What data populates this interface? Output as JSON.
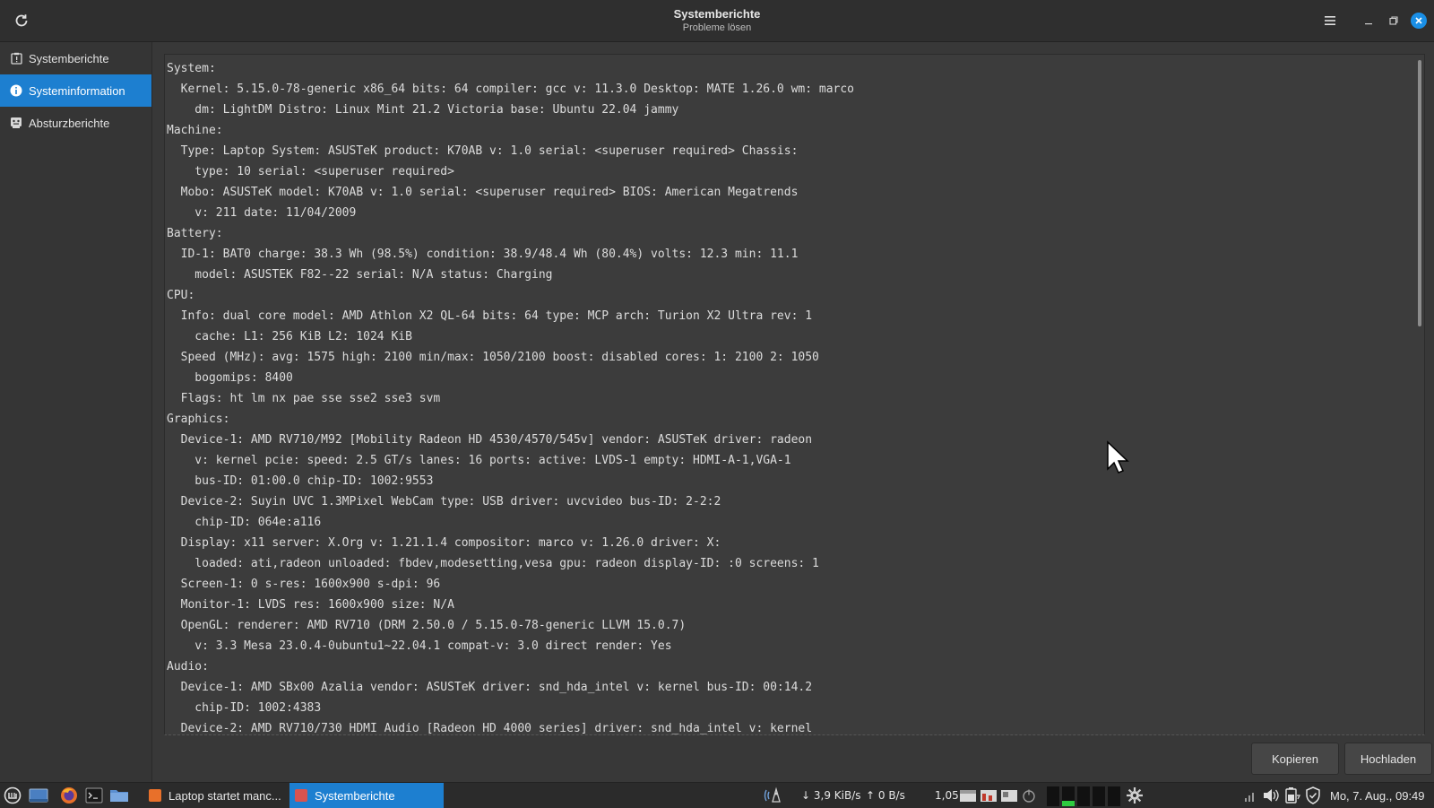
{
  "window": {
    "title": "Systemberichte",
    "subtitle": "Probleme lösen"
  },
  "sidebar": {
    "items": [
      {
        "label": "Systemberichte",
        "icon": "report-icon",
        "active": false
      },
      {
        "label": "Systeminformation",
        "icon": "info-icon",
        "active": true
      },
      {
        "label": "Absturzberichte",
        "icon": "crash-icon",
        "active": false
      }
    ]
  },
  "content": {
    "lines": [
      "System:",
      "  Kernel: 5.15.0-78-generic x86_64 bits: 64 compiler: gcc v: 11.3.0 Desktop: MATE 1.26.0 wm: marco",
      "    dm: LightDM Distro: Linux Mint 21.2 Victoria base: Ubuntu 22.04 jammy",
      "Machine:",
      "  Type: Laptop System: ASUSTeK product: K70AB v: 1.0 serial: <superuser required> Chassis:",
      "    type: 10 serial: <superuser required>",
      "  Mobo: ASUSTeK model: K70AB v: 1.0 serial: <superuser required> BIOS: American Megatrends",
      "    v: 211 date: 11/04/2009",
      "Battery:",
      "  ID-1: BAT0 charge: 38.3 Wh (98.5%) condition: 38.9/48.4 Wh (80.4%) volts: 12.3 min: 11.1",
      "    model: ASUSTEK F82--22 serial: N/A status: Charging",
      "CPU:",
      "  Info: dual core model: AMD Athlon X2 QL-64 bits: 64 type: MCP arch: Turion X2 Ultra rev: 1",
      "    cache: L1: 256 KiB L2: 1024 KiB",
      "  Speed (MHz): avg: 1575 high: 2100 min/max: 1050/2100 boost: disabled cores: 1: 2100 2: 1050",
      "    bogomips: 8400",
      "  Flags: ht lm nx pae sse sse2 sse3 svm",
      "Graphics:",
      "  Device-1: AMD RV710/M92 [Mobility Radeon HD 4530/4570/545v] vendor: ASUSTeK driver: radeon",
      "    v: kernel pcie: speed: 2.5 GT/s lanes: 16 ports: active: LVDS-1 empty: HDMI-A-1,VGA-1",
      "    bus-ID: 01:00.0 chip-ID: 1002:9553",
      "  Device-2: Suyin UVC 1.3MPixel WebCam type: USB driver: uvcvideo bus-ID: 2-2:2",
      "    chip-ID: 064e:a116",
      "  Display: x11 server: X.Org v: 1.21.1.4 compositor: marco v: 1.26.0 driver: X:",
      "    loaded: ati,radeon unloaded: fbdev,modesetting,vesa gpu: radeon display-ID: :0 screens: 1",
      "  Screen-1: 0 s-res: 1600x900 s-dpi: 96",
      "  Monitor-1: LVDS res: 1600x900 size: N/A",
      "  OpenGL: renderer: AMD RV710 (DRM 2.50.0 / 5.15.0-78-generic LLVM 15.0.7)",
      "    v: 3.3 Mesa 23.0.4-0ubuntu1~22.04.1 compat-v: 3.0 direct render: Yes",
      "Audio:",
      "  Device-1: AMD SBx00 Azalia vendor: ASUSTeK driver: snd_hda_intel v: kernel bus-ID: 00:14.2",
      "    chip-ID: 1002:4383",
      "  Device-2: AMD RV710/730 HDMI Audio [Radeon HD 4000 series] driver: snd_hda_intel v: kernel"
    ],
    "copy_label": "Kopieren",
    "upload_label": "Hochladen"
  },
  "taskbar": {
    "tasks": [
      {
        "label": "Laptop startet manc...",
        "active": false
      },
      {
        "label": "Systemberichte",
        "active": true
      }
    ],
    "net_down": "3,9 KiB/s",
    "net_up": "0 B/s",
    "load": "1,05",
    "clock": "Mo, 7. Aug., 09:49"
  },
  "colors": {
    "accent": "#1d7fd0",
    "background": "#383838",
    "text": "#dcdcdc"
  }
}
